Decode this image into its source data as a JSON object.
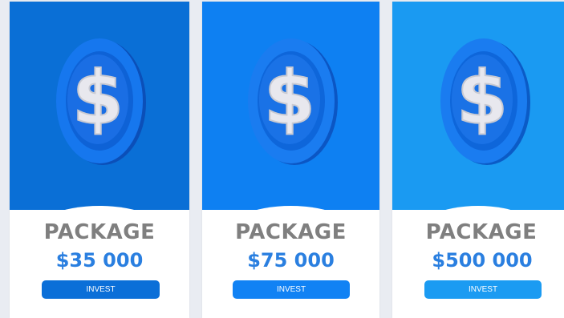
{
  "packages": [
    {
      "title": "PACKAGE",
      "price": "$35 000",
      "button_label": "INVEST",
      "top_color": "#0a6fd6",
      "button_color": "#0b6fd8"
    },
    {
      "title": "PACKAGE",
      "price": "$75 000",
      "button_label": "INVEST",
      "top_color": "#0e80f2",
      "button_color": "#1182f4"
    },
    {
      "title": "PACKAGE",
      "price": "$500 000",
      "button_label": "INVEST",
      "top_color": "#1a9af2",
      "button_color": "#1b9bf2"
    }
  ],
  "icon": "dollar-coin-icon",
  "colors": {
    "price_text": "#2a7fe0",
    "title_text": "#7f7f7f",
    "page_background": "#e9ecf2"
  }
}
